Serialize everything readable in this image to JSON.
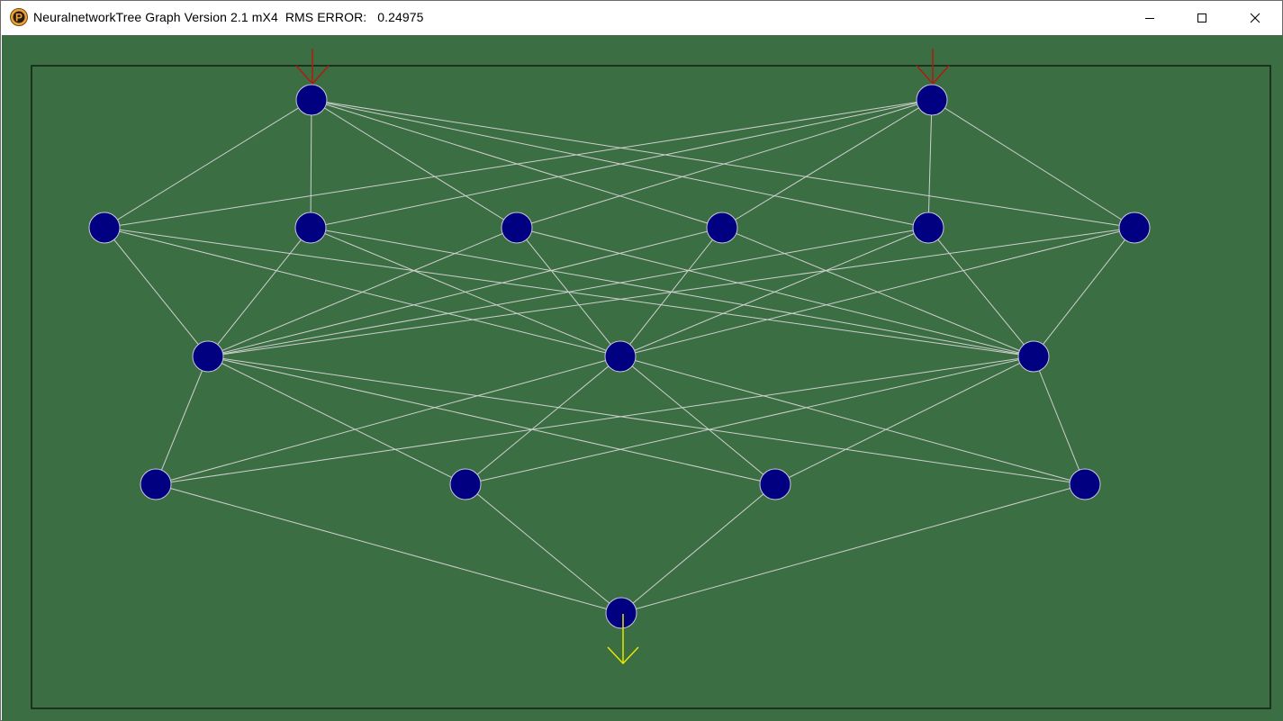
{
  "window": {
    "title": "NeuralnetworkTree Graph Version 2.1 mX4  RMS ERROR:   0.24975",
    "controls": [
      "minimize",
      "maximize",
      "close"
    ]
  },
  "app_icon": {
    "name": "app-logo-icon",
    "letter": "P",
    "color": "#e8a33a"
  },
  "colors": {
    "background": "#3b6e42",
    "frame": "#0f1f12",
    "node_fill": "#000080",
    "node_stroke": "#c8c8d8",
    "edge": "#cfcfcf",
    "input_arrow": "#b01c10",
    "output_arrow": "#e6e600"
  },
  "network": {
    "layers": [
      {
        "name": "input",
        "nodes": 2
      },
      {
        "name": "hidden-1",
        "nodes": 6
      },
      {
        "name": "hidden-2",
        "nodes": 3
      },
      {
        "name": "hidden-3",
        "nodes": 4
      },
      {
        "name": "output",
        "nodes": 1
      }
    ],
    "fully_connected": true,
    "input_arrows": 2,
    "output_arrows": 1
  }
}
